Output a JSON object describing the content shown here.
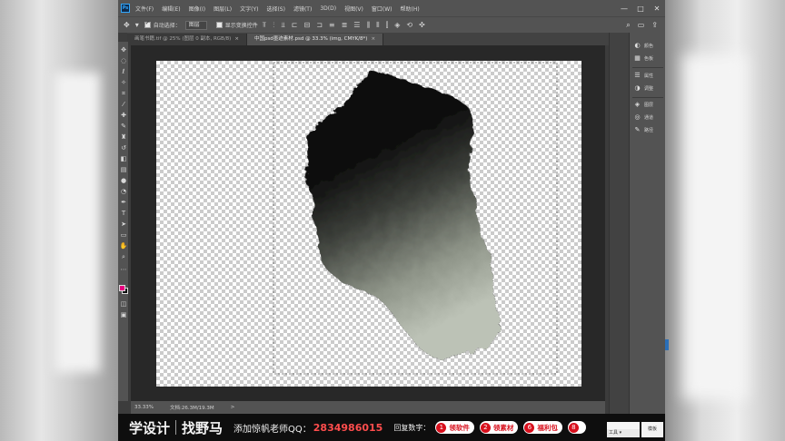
{
  "menubar": {
    "logo": "Ps",
    "items": [
      "文件(F)",
      "编辑(E)",
      "图像(I)",
      "图层(L)",
      "文字(Y)",
      "选择(S)",
      "滤镜(T)",
      "3D(D)",
      "视图(V)",
      "窗口(W)",
      "帮助(H)"
    ],
    "window_controls": [
      "—",
      "□",
      "✕"
    ]
  },
  "options_bar": {
    "auto_select_label": "自动选择：",
    "auto_select_value": "图层",
    "show_transform_label": "显示变换控件",
    "right_icons": [
      "⌕",
      "▭",
      "⇪"
    ]
  },
  "tabs": [
    {
      "label": "画笔书籍.tif @ 25% (图层 0 副本, RGB/8)",
      "close": "×",
      "active": false
    },
    {
      "label": "中国psd墨迹素材.psd @ 33.3% (img, CMYK/8*)",
      "close": "×",
      "active": true
    }
  ],
  "status_bar": {
    "zoom": "33.33%",
    "doc": "文档:26.3M/19.3M",
    "arrow": ">"
  },
  "panels": [
    {
      "icon": "◐",
      "label": "颜色"
    },
    {
      "icon": "▦",
      "label": "色板"
    },
    {
      "icon": "☰",
      "label": "属性"
    },
    {
      "icon": "◑",
      "label": "调整"
    },
    {
      "icon": "◈",
      "label": "图层"
    },
    {
      "icon": "◎",
      "label": "通道"
    },
    {
      "icon": "✎",
      "label": "路径"
    }
  ],
  "banner": {
    "brand_a": "学设计",
    "brand_b": "找野马",
    "contact": "添加惊帆老师QQ：",
    "qq_number": "2834986015",
    "reply_label": "回复数字：",
    "pills": [
      {
        "num": "1",
        "text": "领软件"
      },
      {
        "num": "2",
        "text": "领素材"
      },
      {
        "num": "6",
        "text": "福利包"
      },
      {
        "num": "8",
        "text": ""
      }
    ],
    "tools_label": "工具 ▾",
    "mode_label": "模板"
  },
  "colors": {
    "foreground": "#e6007e",
    "background": "#111111",
    "accent_red": "#d8101d"
  }
}
